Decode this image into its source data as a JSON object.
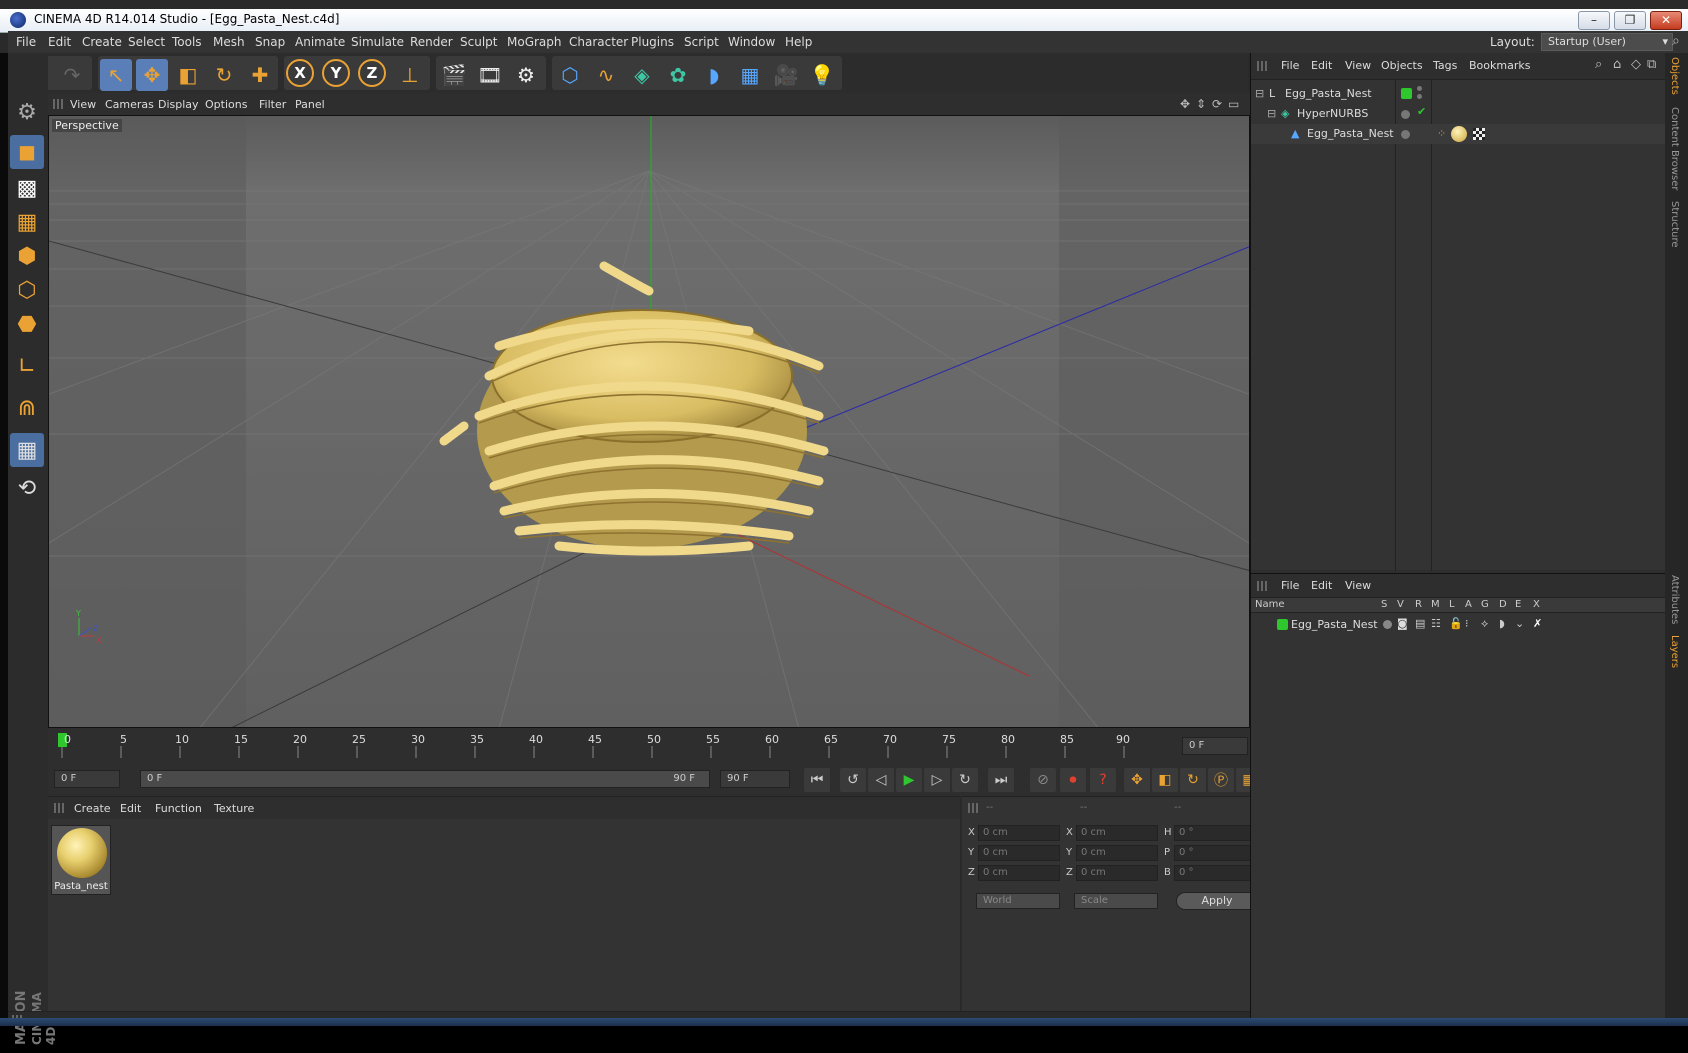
{
  "window": {
    "title": "CINEMA 4D R14.014 Studio - [Egg_Pasta_Nest.c4d]",
    "controls": [
      "–",
      "❐",
      "✕"
    ]
  },
  "menubar": {
    "items": [
      "File",
      "Edit",
      "Create",
      "Select",
      "Tools",
      "Mesh",
      "Snap",
      "Animate",
      "Simulate",
      "Render",
      "Sculpt",
      "MoGraph",
      "Character",
      "Plugins",
      "Script",
      "Window",
      "Help"
    ],
    "layout_label": "Layout:",
    "layout_value": "Startup (User)"
  },
  "toolbar": {
    "icons": [
      "undo-icon",
      "redo-icon",
      "live-select-icon",
      "move-icon",
      "scale-icon",
      "rotate-icon",
      "add-object-icon",
      "x-axis-icon",
      "y-axis-icon",
      "z-axis-icon",
      "world-coords-icon",
      "render-view-icon",
      "render-picture-viewer-icon",
      "render-settings-icon",
      "cube-icon",
      "spline-icon",
      "nurbs-icon",
      "array-icon",
      "deformer-icon",
      "floor-icon",
      "camera-icon",
      "light-icon"
    ],
    "axis_labels": [
      "X",
      "Y",
      "Z"
    ]
  },
  "viewport": {
    "menu": [
      "View",
      "Cameras",
      "Display",
      "Options",
      "Filter",
      "Panel"
    ],
    "label": "Perspective"
  },
  "timeline": {
    "ticks": [
      "0",
      "5",
      "10",
      "15",
      "20",
      "25",
      "30",
      "35",
      "40",
      "45",
      "50",
      "55",
      "60",
      "65",
      "70",
      "75",
      "80",
      "85",
      "90"
    ],
    "current_frame": "0 F"
  },
  "transport": {
    "start_field": "0 F",
    "range_start": "0 F",
    "range_end": "90 F",
    "end_field": "90 F"
  },
  "material_manager": {
    "menu": [
      "Create",
      "Edit",
      "Function",
      "Texture"
    ],
    "material_name": "Pasta_nest"
  },
  "coordinates": {
    "headers": [
      "--",
      "--",
      "--"
    ],
    "rows": [
      {
        "a": "X",
        "a_val": "0 cm",
        "b": "X",
        "b_val": "0 cm",
        "c": "H",
        "c_val": "0 °"
      },
      {
        "a": "Y",
        "a_val": "0 cm",
        "b": "Y",
        "b_val": "0 cm",
        "c": "P",
        "c_val": "0 °"
      },
      {
        "a": "Z",
        "a_val": "0 cm",
        "b": "Z",
        "b_val": "0 cm",
        "c": "B",
        "c_val": "0 °"
      }
    ],
    "mode": "World",
    "transform": "Scale",
    "apply_label": "Apply"
  },
  "object_manager": {
    "menu": [
      "File",
      "Edit",
      "View",
      "Objects",
      "Tags",
      "Bookmarks"
    ],
    "objects": [
      {
        "name": "Egg_Pasta_Nest",
        "icon": "null-object-icon"
      },
      {
        "name": "HyperNURBS",
        "icon": "hypernurbs-icon"
      },
      {
        "name": "Egg_Pasta_Nest",
        "icon": "polygon-object-icon"
      }
    ]
  },
  "layer_manager": {
    "menu": [
      "File",
      "Edit",
      "View"
    ],
    "columns": [
      "Name",
      "S",
      "V",
      "R",
      "M",
      "L",
      "A",
      "G",
      "D",
      "E",
      "X"
    ],
    "layers": [
      {
        "name": "Egg_Pasta_Nest",
        "color": "#2ec72e"
      }
    ]
  },
  "side_tabs": [
    "Objects",
    "Content Browser",
    "Structure",
    "Attributes",
    "Layers"
  ],
  "branding": {
    "maxon": "MAXON",
    "product": "CINEMA 4D"
  },
  "colors": {
    "accent": "#e9a233",
    "selected": "#4b6ea1",
    "layer": "#2ec72e"
  }
}
